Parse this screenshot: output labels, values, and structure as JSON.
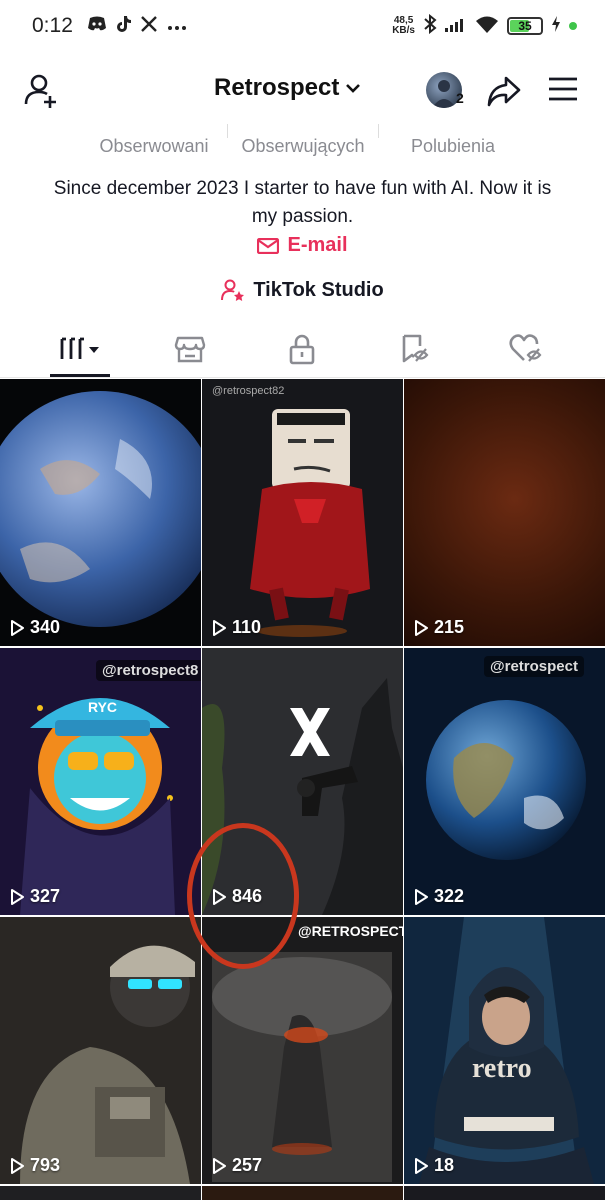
{
  "status_bar": {
    "time": "0:12",
    "net_speed_value": "48,5",
    "net_speed_unit": "KB/s",
    "battery": "35"
  },
  "header": {
    "title": "Retrospect",
    "avatar_badge": "2"
  },
  "stats": [
    {
      "label": "Obserwowani"
    },
    {
      "label": "Obserwujących"
    },
    {
      "label": "Polubienia"
    }
  ],
  "bio": "Since december 2023 I starter to have fun with AI. Now it is my passion.",
  "email_label": "E-mail",
  "studio_label": "TikTok Studio",
  "videos": [
    {
      "views": "340"
    },
    {
      "views": "110",
      "watermark": "@retrospect82"
    },
    {
      "views": "215"
    },
    {
      "views": "327",
      "watermark": "@retrospect8"
    },
    {
      "views": "846"
    },
    {
      "views": "322",
      "watermark": "@retrospect"
    },
    {
      "views": "793"
    },
    {
      "views": "257",
      "watermark": "@RETROSPECT"
    },
    {
      "views": "18"
    }
  ],
  "colors": {
    "accent": "#e8305b",
    "highlight": "#c9371e"
  }
}
